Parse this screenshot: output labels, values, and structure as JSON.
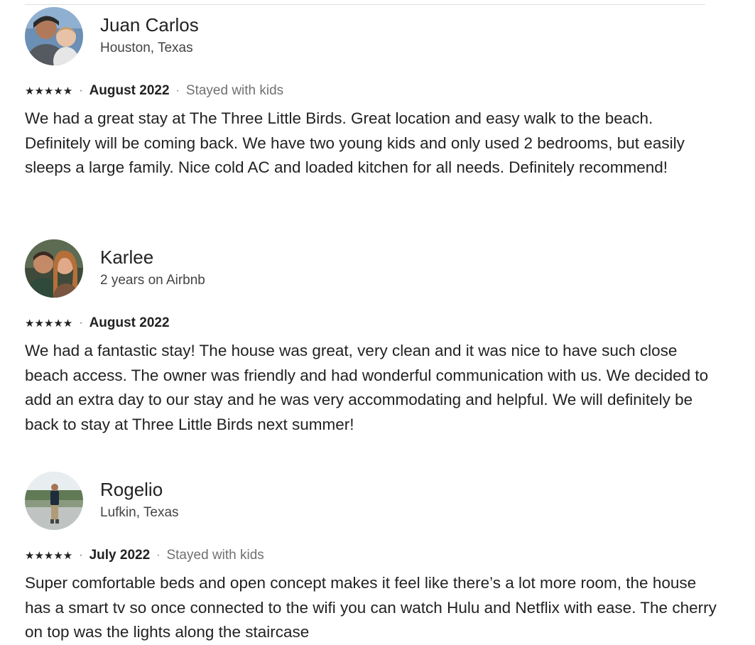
{
  "reviews": [
    {
      "name": "Juan Carlos",
      "subtitle": "Houston, Texas",
      "rating": 5,
      "stars": "★★★★★",
      "separator": "·",
      "date": "August 2022",
      "trip_type": "Stayed with kids",
      "text": "We had a great stay at The Three Little Birds. Great location and easy walk to the beach. Definitely will be coming back. We have two young kids and only used 2 bedrooms, but easily sleeps a large family. Nice cold AC and loaded kitchen for all needs. Definitely recommend!"
    },
    {
      "name": "Karlee",
      "subtitle": "2 years on Airbnb",
      "rating": 5,
      "stars": "★★★★★",
      "separator": "·",
      "date": "August 2022",
      "trip_type": "",
      "text": "We had a fantastic stay! The house was great, very clean and it was nice to have such close beach access. The owner was friendly and had wonderful communication with us. We decided to add an extra day to our stay and he was very accommodating and helpful. We will definitely be back to stay at Three Little Birds next summer!"
    },
    {
      "name": "Rogelio",
      "subtitle": "Lufkin, Texas",
      "rating": 5,
      "stars": "★★★★★",
      "separator": "·",
      "date": "July 2022",
      "trip_type": "Stayed with kids",
      "text": "Super comfortable beds and open concept makes it feel like there’s a lot more room, the house has a smart tv so once connected to the wifi you can watch Hulu and Netflix with ease. The cherry on top was the lights along the staircase"
    }
  ],
  "colors": {
    "text_primary": "#222222",
    "text_secondary": "#717171",
    "divider": "#dddddd",
    "background": "#ffffff"
  }
}
